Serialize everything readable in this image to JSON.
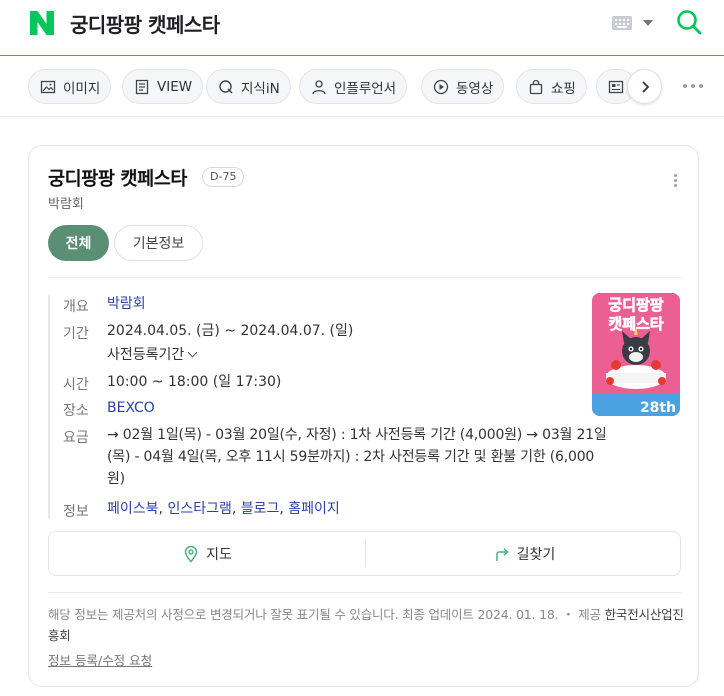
{
  "header": {
    "query": "궁디팡팡 캣페스타",
    "brand_color": "#03c75a"
  },
  "tabs": [
    {
      "label": "이미지",
      "icon": "image-icon"
    },
    {
      "label": "VIEW",
      "icon": "document-icon"
    },
    {
      "label": "지식iN",
      "icon": "q-bubble-icon"
    },
    {
      "label": "인플루언서",
      "icon": "person-icon"
    },
    {
      "label": "동영상",
      "icon": "play-icon"
    },
    {
      "label": "쇼핑",
      "icon": "bag-icon"
    }
  ],
  "card": {
    "title": "궁디팡팡 캣페스타",
    "dday": "D-75",
    "category": "박람회",
    "filters": {
      "all": "전체",
      "basic": "기본정보"
    },
    "rows": {
      "overview": {
        "label": "개요",
        "value": "박람회"
      },
      "period": {
        "label": "기간",
        "value": "2024.04.05. (금) ~  2024.04.07. (일)",
        "sub": "사전등록기간"
      },
      "time": {
        "label": "시간",
        "value": "10:00 ~ 18:00 (일 17:30)"
      },
      "place": {
        "label": "장소",
        "value": "BEXCO"
      },
      "fee": {
        "label": "요금",
        "line1": "→ 02월 1일(목) - 03월 20일(수, 자정) : 1차 사전등록 기간 (4,000원) → 03월 21일",
        "line2": "(목) - 04월 4일(목, 오후 11시 59분까지) : 2차 사전등록 기간 및 환불 기한 (6,000",
        "line3": "원)"
      },
      "info": {
        "label": "정보",
        "links": [
          "페이스북",
          "인스타그램",
          "블로그",
          "홈페이지"
        ]
      }
    },
    "poster": {
      "title_line1": "궁디팡팡",
      "title_line2": "캣페스타",
      "edition": "28th",
      "bg_color": "#ec5f93"
    },
    "actions": {
      "map": "지도",
      "directions": "길찾기"
    },
    "notice": "해당 정보는 제공처의 사정으로 변경되거나 잘못 표기될 수 있습니다. 최종 업데이트 2024. 01. 18.",
    "provider_label": "제공",
    "provider": "한국전시산업진흥회",
    "edit_request": "정보 등록/수정 요청"
  }
}
